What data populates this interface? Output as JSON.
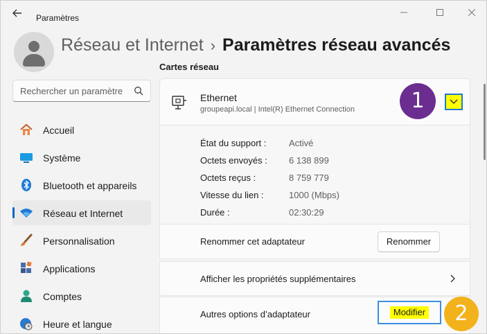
{
  "window": {
    "title": "Paramètres",
    "back_icon": "arrow-left-icon",
    "controls": [
      "minimize-icon",
      "maximize-icon",
      "close-icon"
    ]
  },
  "header": {
    "parent": "Réseau et Internet",
    "separator": "›",
    "current": "Paramètres réseau avancés"
  },
  "search": {
    "placeholder": "Rechercher un paramètre",
    "icon": "search-icon"
  },
  "sidebar": {
    "items": [
      {
        "label": "Accueil",
        "icon": "home-icon",
        "active": false
      },
      {
        "label": "Système",
        "icon": "monitor-icon",
        "active": false
      },
      {
        "label": "Bluetooth et appareils",
        "icon": "bluetooth-icon",
        "active": false
      },
      {
        "label": "Réseau et Internet",
        "icon": "wifi-icon",
        "active": true
      },
      {
        "label": "Personnalisation",
        "icon": "brush-icon",
        "active": false
      },
      {
        "label": "Applications",
        "icon": "apps-icon",
        "active": false
      },
      {
        "label": "Comptes",
        "icon": "person-icon",
        "active": false
      },
      {
        "label": "Heure et langue",
        "icon": "clock-globe-icon",
        "active": false
      }
    ],
    "accent": "#0067c0"
  },
  "main": {
    "section_title": "Cartes réseau",
    "adapter": {
      "name": "Ethernet",
      "description": "groupeapi.local | Intel(R) Ethernet Connection",
      "icon": "ethernet-icon",
      "expand_icon": "chevron-down-icon"
    },
    "details": [
      {
        "key": "État du support :",
        "value": "Activé"
      },
      {
        "key": "Octets envoyés :",
        "value": "6 138 899"
      },
      {
        "key": "Octets reçus :",
        "value": "8 759 779"
      },
      {
        "key": "Vitesse du lien :",
        "value": "1000 (Mbps)"
      },
      {
        "key": "Durée :",
        "value": "02:30:29"
      }
    ],
    "rename_row": {
      "label": "Renommer cet adaptateur",
      "button": "Renommer"
    },
    "properties_row": {
      "label": "Afficher les propriétés supplémentaires",
      "icon": "chevron-right-icon"
    },
    "options_row": {
      "label": "Autres options d’adaptateur",
      "button": "Modifier"
    }
  },
  "annotations": {
    "step1": "1",
    "step2": "2",
    "step1_color": "#6b2d8f",
    "step2_color": "#f2b21b",
    "highlight_color": "#ffff00"
  }
}
